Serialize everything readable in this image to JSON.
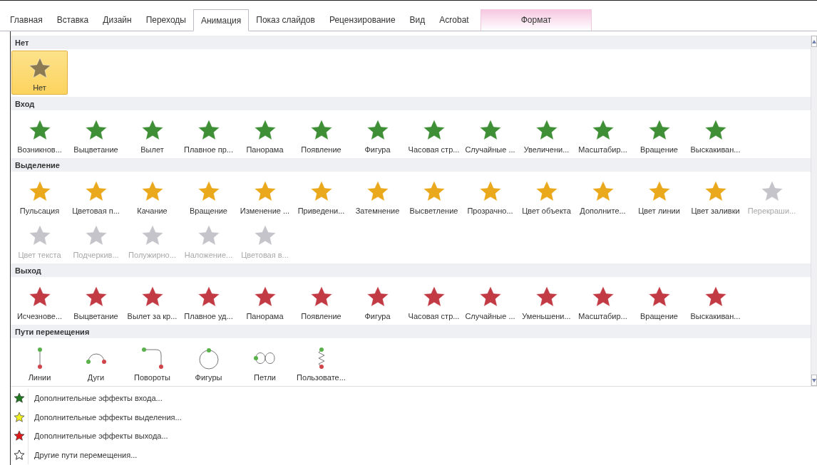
{
  "tabs": [
    {
      "label": "Главная",
      "selected": false,
      "contextual": false
    },
    {
      "label": "Вставка",
      "selected": false,
      "contextual": false
    },
    {
      "label": "Дизайн",
      "selected": false,
      "contextual": false
    },
    {
      "label": "Переходы",
      "selected": false,
      "contextual": false
    },
    {
      "label": "Анимация",
      "selected": true,
      "contextual": false
    },
    {
      "label": "Показ слайдов",
      "selected": false,
      "contextual": false
    },
    {
      "label": "Рецензирование",
      "selected": false,
      "contextual": false
    },
    {
      "label": "Вид",
      "selected": false,
      "contextual": false
    },
    {
      "label": "Acrobat",
      "selected": false,
      "contextual": false
    },
    {
      "label": "Формат",
      "selected": false,
      "contextual": true
    }
  ],
  "sections": [
    {
      "title": "Нет",
      "kind": "none",
      "items": [
        {
          "label": "Нет",
          "selected": true
        }
      ]
    },
    {
      "title": "Вход",
      "kind": "entrance",
      "items": [
        {
          "label": "Возникнов...",
          "selected": false
        },
        {
          "label": "Выцветание",
          "selected": false
        },
        {
          "label": "Вылет",
          "selected": false
        },
        {
          "label": "Плавное пр...",
          "selected": false
        },
        {
          "label": "Панорама",
          "selected": false
        },
        {
          "label": "Появление",
          "selected": false
        },
        {
          "label": "Фигура",
          "selected": false
        },
        {
          "label": "Часовая стр...",
          "selected": false
        },
        {
          "label": "Случайные ...",
          "selected": false
        },
        {
          "label": "Увеличени...",
          "selected": false
        },
        {
          "label": "Масштабир...",
          "selected": false
        },
        {
          "label": "Вращение",
          "selected": false
        },
        {
          "label": "Выскакиван...",
          "selected": false
        }
      ]
    },
    {
      "title": "Выделение",
      "kind": "emphasis",
      "items": [
        {
          "label": "Пульсация",
          "selected": false,
          "disabled": false
        },
        {
          "label": "Цветовая п...",
          "selected": false,
          "disabled": false
        },
        {
          "label": "Качание",
          "selected": false,
          "disabled": false
        },
        {
          "label": "Вращение",
          "selected": false,
          "disabled": false
        },
        {
          "label": "Изменение ...",
          "selected": false,
          "disabled": false
        },
        {
          "label": "Приведени...",
          "selected": false,
          "disabled": false
        },
        {
          "label": "Затемнение",
          "selected": false,
          "disabled": false
        },
        {
          "label": "Высветление",
          "selected": false,
          "disabled": false
        },
        {
          "label": "Прозрачно...",
          "selected": false,
          "disabled": false
        },
        {
          "label": "Цвет объекта",
          "selected": false,
          "disabled": false
        },
        {
          "label": "Дополните...",
          "selected": false,
          "disabled": false
        },
        {
          "label": "Цвет линии",
          "selected": false,
          "disabled": false
        },
        {
          "label": "Цвет заливки",
          "selected": false,
          "disabled": false
        },
        {
          "label": "Перекраши...",
          "selected": false,
          "disabled": true
        },
        {
          "label": "Цвет текста",
          "selected": false,
          "disabled": true
        },
        {
          "label": "Подчеркив...",
          "selected": false,
          "disabled": true
        },
        {
          "label": "Полужирно...",
          "selected": false,
          "disabled": true
        },
        {
          "label": "Наложение...",
          "selected": false,
          "disabled": true
        },
        {
          "label": "Цветовая в...",
          "selected": false,
          "disabled": true
        }
      ]
    },
    {
      "title": "Выход",
      "kind": "exit",
      "items": [
        {
          "label": "Исчезнове...",
          "selected": false
        },
        {
          "label": "Выцветание",
          "selected": false
        },
        {
          "label": "Вылет за кр...",
          "selected": false
        },
        {
          "label": "Плавное уд...",
          "selected": false
        },
        {
          "label": "Панорама",
          "selected": false
        },
        {
          "label": "Появление",
          "selected": false
        },
        {
          "label": "Фигура",
          "selected": false
        },
        {
          "label": "Часовая стр...",
          "selected": false
        },
        {
          "label": "Случайные ...",
          "selected": false
        },
        {
          "label": "Уменьшени...",
          "selected": false
        },
        {
          "label": "Масштабир...",
          "selected": false
        },
        {
          "label": "Вращение",
          "selected": false
        },
        {
          "label": "Выскакиван...",
          "selected": false
        }
      ]
    },
    {
      "title": "Пути перемещения",
      "kind": "path",
      "items": [
        {
          "label": "Линии",
          "selected": false,
          "kind": "line"
        },
        {
          "label": "Дуги",
          "selected": false,
          "kind": "arc"
        },
        {
          "label": "Повороты",
          "selected": false,
          "kind": "turn"
        },
        {
          "label": "Фигуры",
          "selected": false,
          "kind": "circle"
        },
        {
          "label": "Петли",
          "selected": false,
          "kind": "loop"
        },
        {
          "label": "Пользовате...",
          "selected": false,
          "kind": "custom"
        }
      ]
    }
  ],
  "menu": [
    {
      "label": "Дополнительные эффекты входа...",
      "kind": "entrance"
    },
    {
      "label": "Дополнительные эффекты выделения...",
      "kind": "emphasis"
    },
    {
      "label": "Дополнительные эффекты выхода...",
      "kind": "exit"
    },
    {
      "label": "Другие пути перемещения...",
      "kind": "path"
    }
  ]
}
